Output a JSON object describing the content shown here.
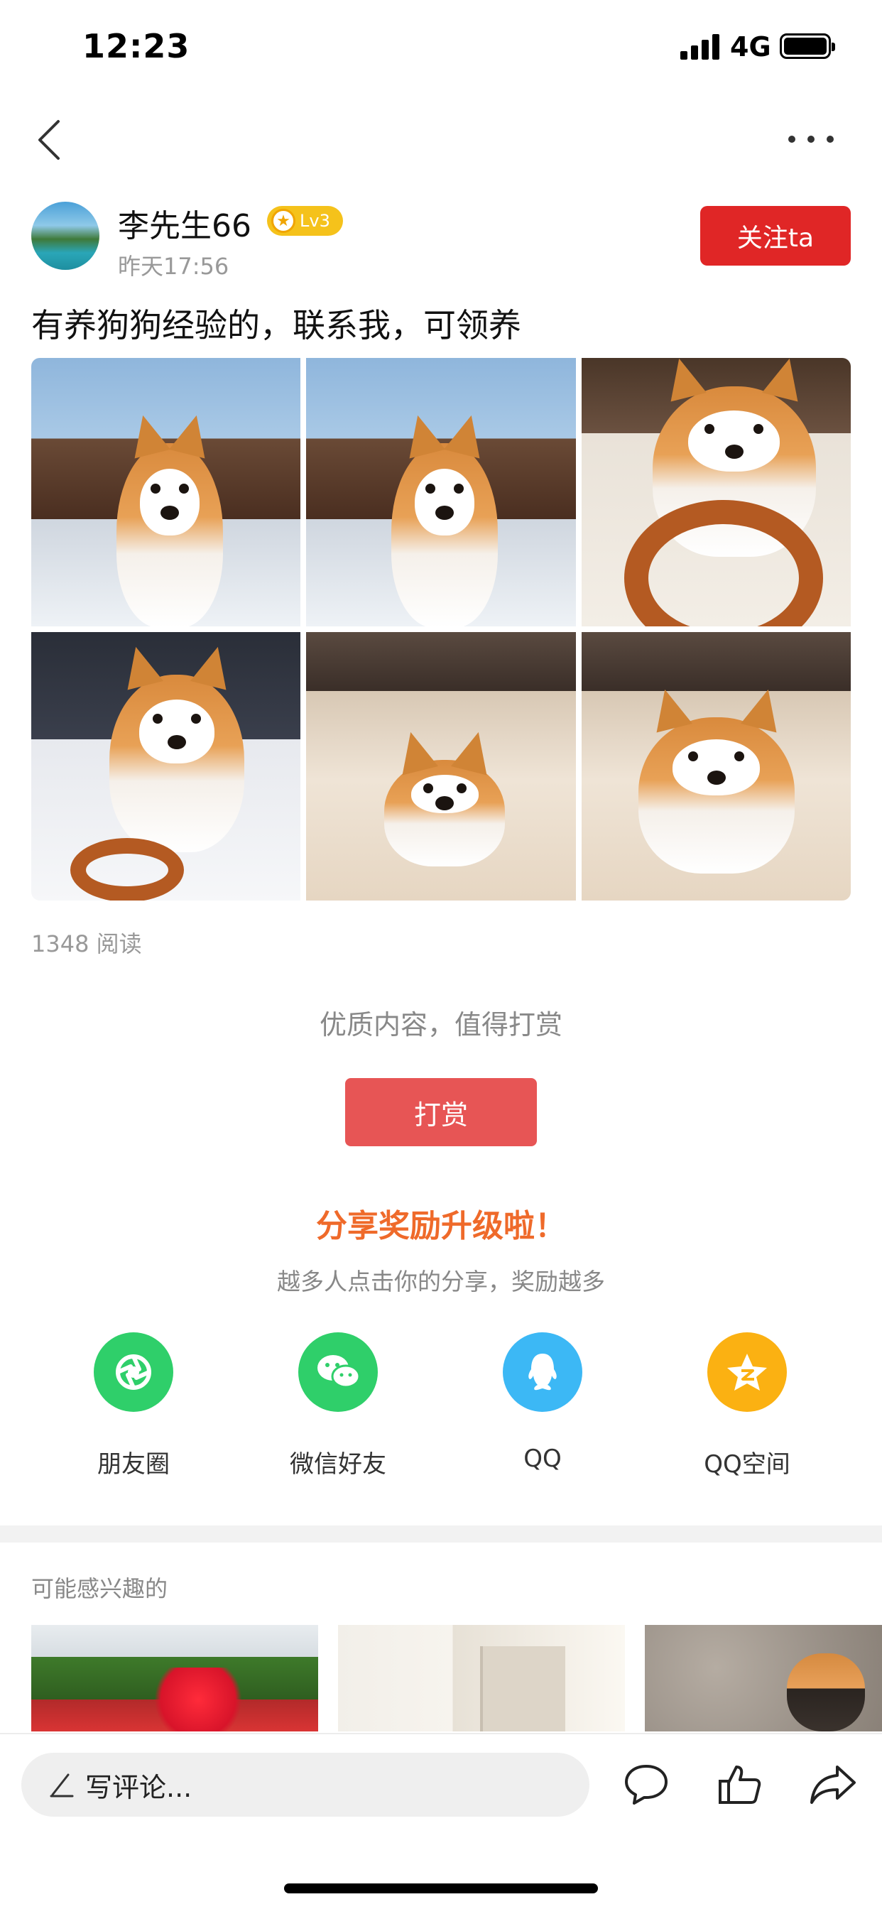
{
  "status_bar": {
    "time": "12:23",
    "network": "4G"
  },
  "author": {
    "name": "李先生66",
    "level": "Lv3",
    "time": "昨天17:56",
    "follow_label": "关注ta"
  },
  "post": {
    "title": "有养狗狗经验的，联系我，可领养",
    "images": [
      "corgi-sitting-by-sofa",
      "corgi-sitting-by-sofa",
      "corgi-with-chew-ring",
      "corgi-with-donut-treat",
      "corgi-lying-on-floor",
      "corgi-standing-on-floor"
    ],
    "read_count": "1348 阅读"
  },
  "reward": {
    "hint": "优质内容，值得打赏",
    "button_label": "打赏"
  },
  "share": {
    "title": "分享奖励升级啦！",
    "subtitle": "越多人点击你的分享，奖励越多",
    "items": [
      {
        "label": "朋友圈",
        "icon": "moments-icon",
        "color": "#2fcf6a"
      },
      {
        "label": "微信好友",
        "icon": "wechat-icon",
        "color": "#2fcf6a"
      },
      {
        "label": "QQ",
        "icon": "qq-icon",
        "color": "#3cb8f5"
      },
      {
        "label": "QQ空间",
        "icon": "qzone-icon",
        "color": "#fbb112"
      }
    ]
  },
  "recommend": {
    "title": "可能感兴趣的"
  },
  "bottom_bar": {
    "comment_placeholder": "写评论..."
  },
  "colors": {
    "accent_red": "#e02626",
    "reward_red": "#e75555",
    "share_orange": "#ef6a2a"
  }
}
